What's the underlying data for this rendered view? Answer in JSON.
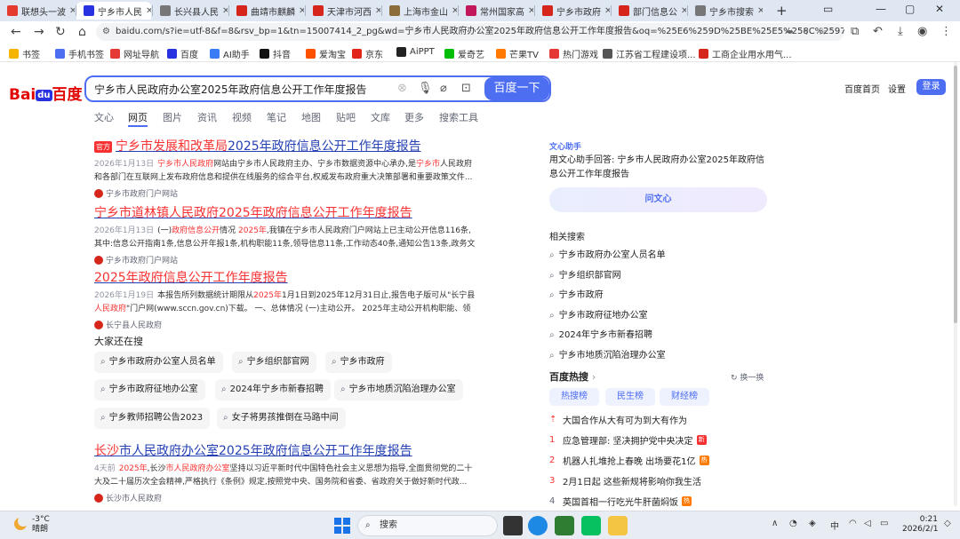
{
  "browser": {
    "tabs": [
      {
        "label": "联想头一波",
        "color": "#e33b2e",
        "active": false
      },
      {
        "label": "宁乡市人民",
        "color": "#2932e1",
        "active": true
      },
      {
        "label": "长兴县人民",
        "color": "#777777",
        "active": false
      },
      {
        "label": "曲靖市麒麟",
        "color": "#d6261b",
        "active": false
      },
      {
        "label": "天津市河西",
        "color": "#d6261b",
        "active": false
      },
      {
        "label": "上海市金山",
        "color": "#8a6d3b",
        "active": false
      },
      {
        "label": "常州国家高",
        "color": "#c2185b",
        "active": false
      },
      {
        "label": "宁乡市政府",
        "color": "#d6261b",
        "active": false
      },
      {
        "label": "部门信息公",
        "color": "#d6261b",
        "active": false
      },
      {
        "label": "宁乡市搜索",
        "color": "#777777",
        "active": false
      }
    ],
    "new_tab": "+",
    "address": "baidu.com/s?ie=utf-8&f=8&rsv_bp=1&tn=15007414_2_pg&wd=宁乡市人民政府办公室2025年政府信息公开工作年度报告&oq=%25E6%259D%25BE%25E5%258C%2597%25E5%258C%2..."
  },
  "bookmarks": [
    {
      "label": "书签",
      "color": "#f4b400"
    },
    {
      "label": "手机书签",
      "color": "#4e6ef2"
    },
    {
      "label": "网址导航",
      "color": "#e53935"
    },
    {
      "label": "百度",
      "color": "#2932e1"
    },
    {
      "label": "AI助手",
      "color": "#3b7cf6"
    },
    {
      "label": "抖音",
      "color": "#111111"
    },
    {
      "label": "爱淘宝",
      "color": "#ff5000"
    },
    {
      "label": "京东",
      "color": "#e1251b"
    },
    {
      "label": "AiPPT",
      "color": "#222222"
    },
    {
      "label": "爱奇艺",
      "color": "#00be06"
    },
    {
      "label": "芒果TV",
      "color": "#ff7a00"
    },
    {
      "label": "热门游戏",
      "color": "#e53935"
    },
    {
      "label": "江苏省工程建设项...",
      "color": "#555555"
    },
    {
      "label": "工商企业用水用气...",
      "color": "#d6261b"
    }
  ],
  "logo": {
    "left": "Bai",
    "paw": "du",
    "right": "百度"
  },
  "search": {
    "query": "宁乡市人民政府办公室2025年政府信息公开工作年度报告",
    "button": "百度一下"
  },
  "top_links": {
    "home": "百度首页",
    "settings": "设置",
    "login": "登录"
  },
  "search_tabs": [
    "文心",
    "网页",
    "图片",
    "资讯",
    "视频",
    "笔记",
    "地图",
    "贴吧",
    "文库",
    "更多",
    "搜索工具"
  ],
  "results": [
    {
      "official": "官方",
      "title_hl": "宁乡市发展和改革局",
      "title_rest": "2025年政府信息公开工作年度报告",
      "date": "2026年1月13日",
      "desc_a": "",
      "desc_hl1": "宁乡市人民政府",
      "desc_b": "网站由宁乡市人民政府主办、宁乡市数据资源中心承办,是",
      "desc_hl2": "宁乡市",
      "desc_c": "人民政府和各部门在互联网上发布政府信息和提供在线服务的综合平台,权威发布政府重大决策部署和重要政策文件...",
      "source": "宁乡市政府门户网站"
    },
    {
      "official": "",
      "title_hl": "宁乡市道林镇人民政府2025年政府信息公开工作年度报告",
      "title_rest": "",
      "date": "2026年1月13日",
      "desc_a": "(一)",
      "desc_hl1": "政府信息公开",
      "desc_b": "情况 ",
      "desc_hl2": "2025年",
      "desc_c": ",我镇在宁乡市人民政府门户网站上已主动公开信息116条,其中:信息公开指南1条,信息公开年报1条,机构职能11条,领导信息11条,工作动态40条,通知公告13条,政务文件2条...",
      "source": "宁乡市政府门户网站"
    },
    {
      "official": "",
      "title_hl": "2025年政府信息公开工作年度报告",
      "title_rest": "",
      "date": "2026年1月19日",
      "desc_a": "本报告所列数据统计期限从",
      "desc_hl1": "2025年",
      "desc_b": "1月1日到2025年12月31日止,报告电子版可从\"长宁县",
      "desc_hl2": "人民政府",
      "desc_c": "\"门户网(www.sccn.gov.cn)下载。 一、总体情况 (一)主动公开。 2025年主动公开机构职能、领导...",
      "source": "长宁县人民政府"
    },
    {
      "official": "",
      "title_hl": "长沙",
      "title_rest": "市人民政府办公室2025年政府信息公开工作年度报告",
      "date": "4天前",
      "desc_a": "",
      "desc_hl1": "2025年",
      "desc_b": ",长沙",
      "desc_hl2": "市人民政府办公室",
      "desc_c": "坚持以习近平新时代中国特色社会主义思想为指导,全面贯彻党的二十大及二十届历次全会精神,严格执行《条例》规定,按照党中央、国务院和省委、省政府关于做好新时代政...",
      "source": "长沙市人民政府"
    }
  ],
  "also_search": {
    "title": "大家还在搜",
    "items": [
      "宁乡市政府办公室人员名单",
      "宁乡组织部官网",
      "宁乡市政府",
      "宁乡市政府征地办公室",
      "2024年宁乡市新春招聘",
      "宁乡市地质沉陷治理办公室",
      "宁乡教师招聘公告2023",
      "女子将男孩推倒在马路中间"
    ]
  },
  "wenxin": {
    "label": "文心助手",
    "text": "用文心助手回答: 宁乡市人民政府办公室2025年政府信息公开工作年度报告",
    "button": "问文心"
  },
  "related": {
    "title": "相关搜索",
    "items": [
      "宁乡市政府办公室人员名单",
      "宁乡组织部官网",
      "宁乡市政府",
      "宁乡市政府征地办公室",
      "2024年宁乡市新春招聘",
      "宁乡市地质沉陷治理办公室"
    ]
  },
  "hotlist": {
    "title": "百度热搜",
    "refresh": "换一换",
    "tabs": [
      "热搜榜",
      "民生榜",
      "财经榜"
    ],
    "items": [
      {
        "rank": "⇡",
        "text": "大国合作从大有可为到大有作为",
        "badge": "",
        "badge_color": ""
      },
      {
        "rank": "1",
        "text": "应急管理部: 坚决拥护党中央决定",
        "badge": "新",
        "badge_color": "#f73131"
      },
      {
        "rank": "2",
        "text": "机器人扎堆抢上春晚 出场要花1亿",
        "badge": "热",
        "badge_color": "#ff7a00"
      },
      {
        "rank": "3",
        "text": "2月1日起 这些新规将影响你我生活",
        "badge": "",
        "badge_color": ""
      },
      {
        "rank": "4",
        "text": "英国首相一行吃光牛肝菌焖饭",
        "badge": "热",
        "badge_color": "#ff7a00"
      }
    ]
  },
  "taskbar": {
    "temp": "-3°C",
    "weather": "晴朗",
    "search": "搜索",
    "ime": "中",
    "time": "0:21",
    "date": "2026/2/1"
  }
}
